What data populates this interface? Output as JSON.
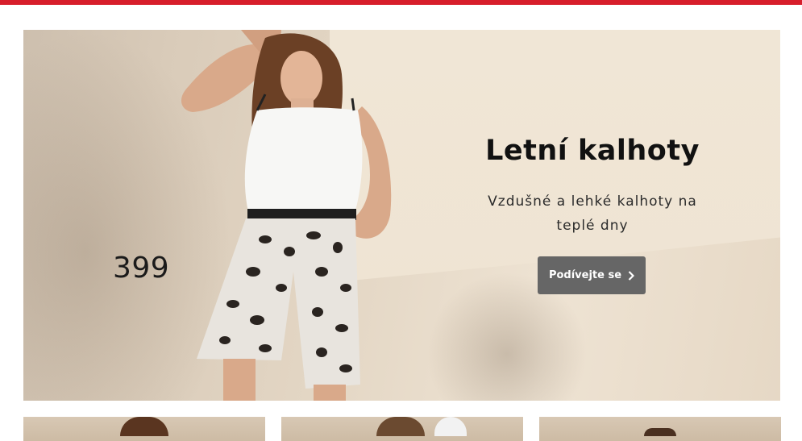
{
  "banner": {
    "price": "399",
    "title": "Letní kalhoty",
    "subtitle": "Vzdušné a lehké kalhoty na teplé dny",
    "cta_label": "Podívejte se",
    "cta_icon": "chevron-right-icon"
  },
  "colors": {
    "accent_bar": "#d71e2b",
    "cta_background": "#666666",
    "cta_text": "#ffffff"
  },
  "product_tiles": [
    {
      "name": "product-tile-1"
    },
    {
      "name": "product-tile-2"
    },
    {
      "name": "product-tile-3"
    }
  ]
}
